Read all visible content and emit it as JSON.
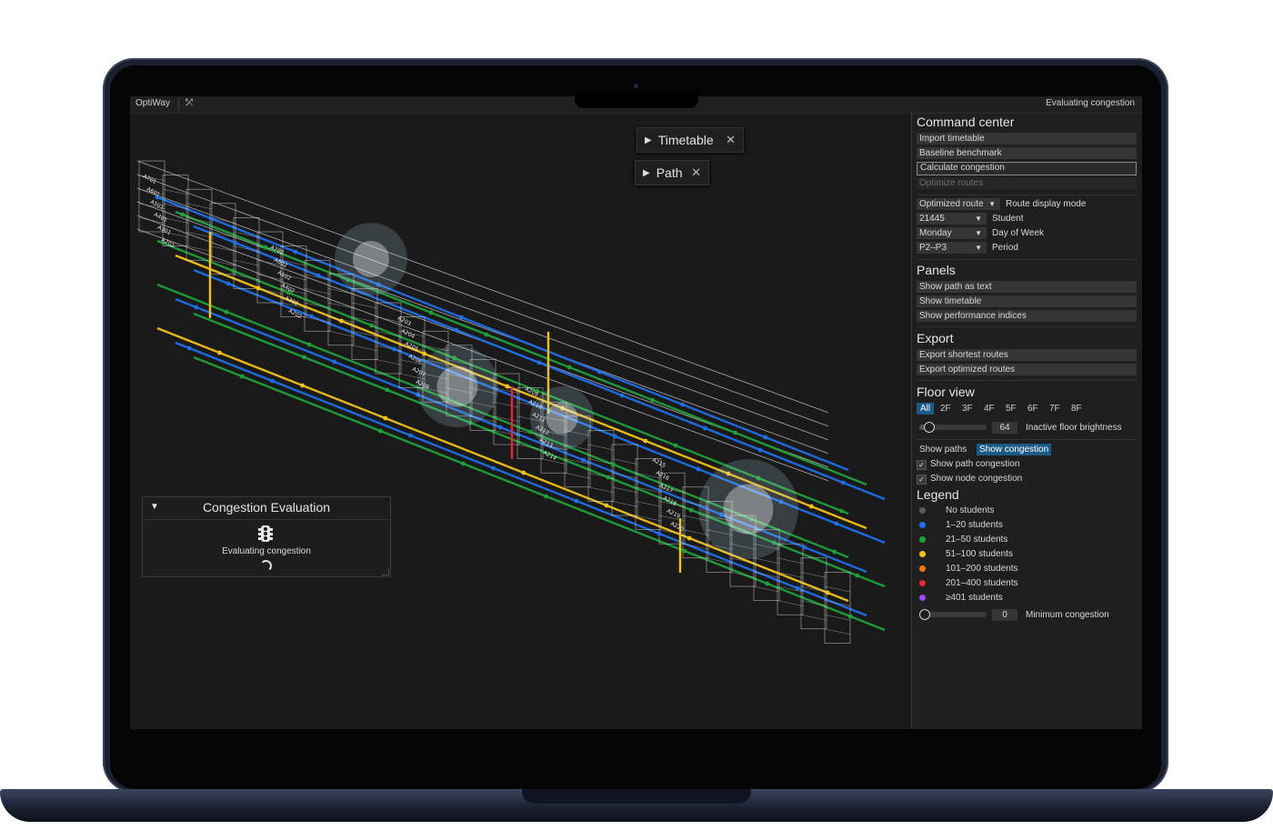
{
  "app": {
    "name": "OptiWay",
    "status": "Evaluating congestion"
  },
  "viewport": {
    "float_buttons": [
      {
        "label": "Timetable"
      },
      {
        "label": "Path"
      }
    ],
    "room_labels": [
      "A701",
      "A601",
      "A501",
      "A401",
      "A301",
      "A201",
      "A702",
      "A602",
      "A502",
      "A402",
      "A302",
      "A202",
      "A203",
      "A204",
      "A205",
      "A206",
      "A207",
      "A208",
      "A209",
      "A210",
      "A211",
      "A212",
      "A213",
      "A214",
      "A215",
      "A216",
      "A217",
      "A218",
      "A219",
      "A220"
    ],
    "congestion_panel": {
      "title": "Congestion Evaluation",
      "status": "Evaluating congestion"
    }
  },
  "sidebar": {
    "command_center": {
      "title": "Command center",
      "buttons": [
        "Import timetable",
        "Baseline benchmark",
        "Calculate congestion",
        "Optimize routes"
      ]
    },
    "route_display": {
      "value": "Optimized route",
      "label": "Route display mode"
    },
    "student": {
      "value": "21445",
      "label": "Student"
    },
    "day": {
      "value": "Monday",
      "label": "Day of Week"
    },
    "period": {
      "value": "P2–P3",
      "label": "Period"
    },
    "panels": {
      "title": "Panels",
      "buttons": [
        "Show path as text",
        "Show timetable",
        "Show performance indices"
      ]
    },
    "export": {
      "title": "Export",
      "buttons": [
        "Export shortest routes",
        "Export optimized routes"
      ]
    },
    "floor_view": {
      "title": "Floor view",
      "floors": [
        "All",
        "2F",
        "3F",
        "4F",
        "5F",
        "6F",
        "7F",
        "8F"
      ],
      "brightness_value": "64",
      "brightness_label": "Inactive floor brightness",
      "brightness_level": 0.08
    },
    "view_tabs": [
      "Show paths",
      "Show congestion"
    ],
    "checks": [
      "Show path congestion",
      "Show node congestion"
    ],
    "legend": {
      "title": "Legend",
      "items": [
        {
          "label": "No students",
          "color": "#5a5a5a"
        },
        {
          "label": "1–20 students",
          "color": "#1f6fe8"
        },
        {
          "label": "21–50 students",
          "color": "#20a03a"
        },
        {
          "label": "51–100 students",
          "color": "#f4c21a"
        },
        {
          "label": "101–200 students",
          "color": "#f07a12"
        },
        {
          "label": "201–400 students",
          "color": "#e8243a"
        },
        {
          "label": "≥401 students",
          "color": "#9a4cf0"
        }
      ]
    },
    "min_congestion": {
      "value": "0",
      "label": "Minimum congestion",
      "level": 0
    }
  }
}
